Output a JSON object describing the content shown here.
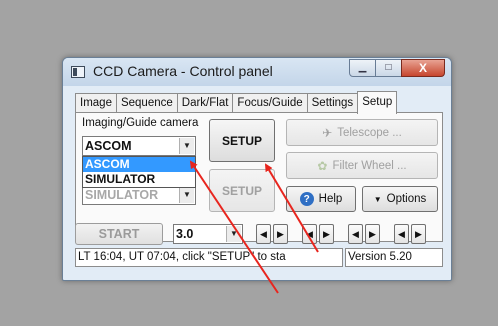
{
  "window": {
    "title": "CCD Camera - Control panel",
    "controls": {
      "minimize": "▁",
      "maximize": "□",
      "close": "X"
    }
  },
  "tabs": [
    {
      "label": "Image"
    },
    {
      "label": "Sequence"
    },
    {
      "label": "Dark/Flat"
    },
    {
      "label": "Focus/Guide"
    },
    {
      "label": "Settings"
    },
    {
      "label": "Setup",
      "active": true
    }
  ],
  "setup": {
    "camera_label": "Imaging/Guide camera",
    "camera_value": "ASCOM",
    "camera_options": [
      "ASCOM",
      "SIMULATOR"
    ],
    "second_camera_value": "SIMULATOR",
    "setup_button": "SETUP",
    "setup_button_2": "SETUP",
    "telescope_button": "Telescope ...",
    "filter_wheel_button": "Filter Wheel ...",
    "help_button": "Help",
    "options_button": "Options"
  },
  "bottom": {
    "start_button": "START",
    "exposure_value": "3.0",
    "status_text": "LT 16:04,  UT 07:04,  click \"SETUP\" to sta",
    "version_text": "Version 5.20"
  },
  "icons": {
    "telescope": "telescope-icon",
    "filter_wheel": "filter-wheel-icon",
    "help": "help-icon",
    "options": "chevron-down-icon"
  },
  "colors": {
    "selection": "#3399ff",
    "annotation_arrow": "#e8251e",
    "close_button": "#c7462e"
  }
}
